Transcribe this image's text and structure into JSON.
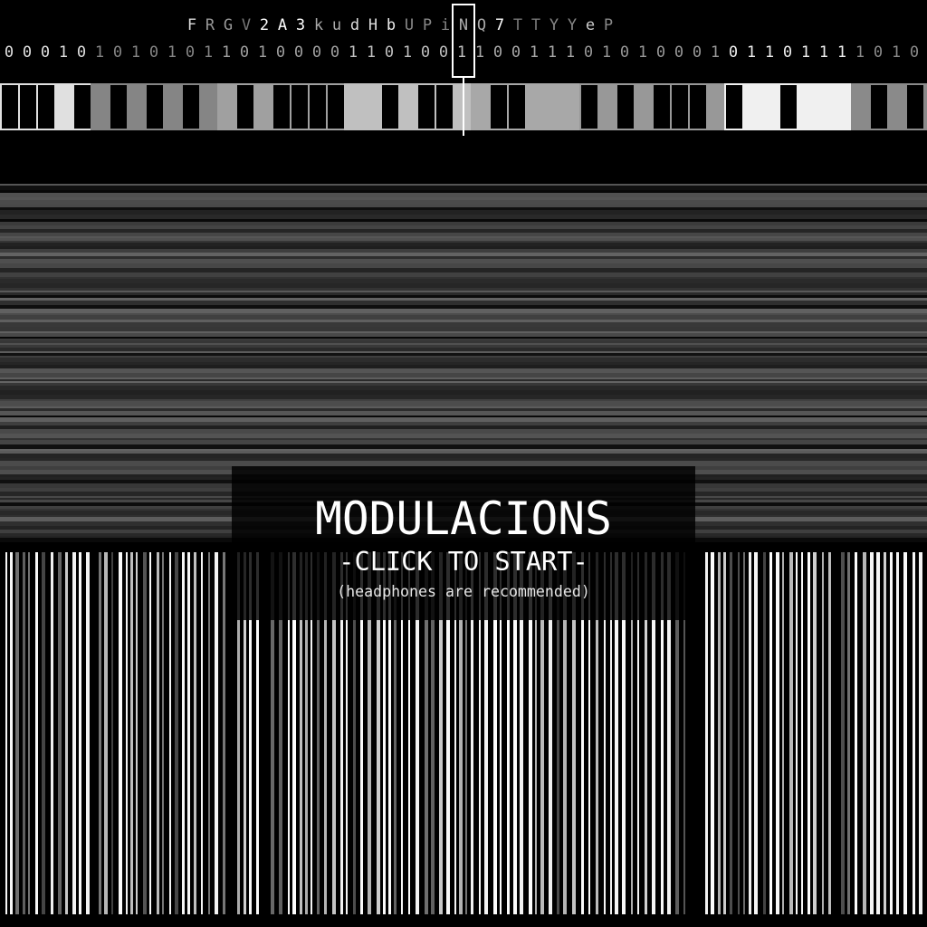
{
  "header": {
    "characters": [
      {
        "char": "F",
        "color": "#dddddd"
      },
      {
        "char": "R",
        "color": "#999999"
      },
      {
        "char": "G",
        "color": "#999999"
      },
      {
        "char": "V",
        "color": "#777777"
      },
      {
        "char": "2",
        "color": "#ffffff"
      },
      {
        "char": "A",
        "color": "#ffffff"
      },
      {
        "char": "3",
        "color": "#ffffff"
      },
      {
        "char": "k",
        "color": "#aaaaaa"
      },
      {
        "char": "u",
        "color": "#aaaaaa"
      },
      {
        "char": "d",
        "color": "#dddddd"
      },
      {
        "char": "H",
        "color": "#dddddd"
      },
      {
        "char": "b",
        "color": "#eeeeee"
      },
      {
        "char": "U",
        "color": "#888888"
      },
      {
        "char": "P",
        "color": "#888888"
      },
      {
        "char": "i",
        "color": "#888888"
      },
      {
        "char": "N",
        "color": "#aaaaaa"
      },
      {
        "char": "Q",
        "color": "#aaaaaa"
      },
      {
        "char": "7",
        "color": "#ffffff"
      },
      {
        "char": "T",
        "color": "#777777"
      },
      {
        "char": "T",
        "color": "#777777"
      },
      {
        "char": "Y",
        "color": "#888888"
      },
      {
        "char": "Y",
        "color": "#888888"
      },
      {
        "char": "e",
        "color": "#cccccc"
      },
      {
        "char": "P",
        "color": "#888888"
      }
    ],
    "selected_char_index": 15,
    "bits": "000101010101101000011010011001110101000101101111010",
    "bit_groups": [
      {
        "count": 5,
        "color": "#e0e0e0"
      },
      {
        "count": 7,
        "color": "#858585"
      },
      {
        "count": 7,
        "color": "#a0a0a0"
      },
      {
        "count": 7,
        "color": "#c0c0c0"
      },
      {
        "count": 6,
        "color": "#a8a8a8"
      },
      {
        "count": 8,
        "color": "#989898"
      },
      {
        "count": 7,
        "color": "#f0f0f0"
      },
      {
        "count": 4,
        "color": "#8a8a8a"
      }
    ]
  },
  "overlay": {
    "title": "MODULACIONS",
    "start_label": "-CLICK TO START-",
    "hint": "(headphones are recommended)"
  },
  "colors": {
    "background": "#000000",
    "text": "#ffffff"
  }
}
